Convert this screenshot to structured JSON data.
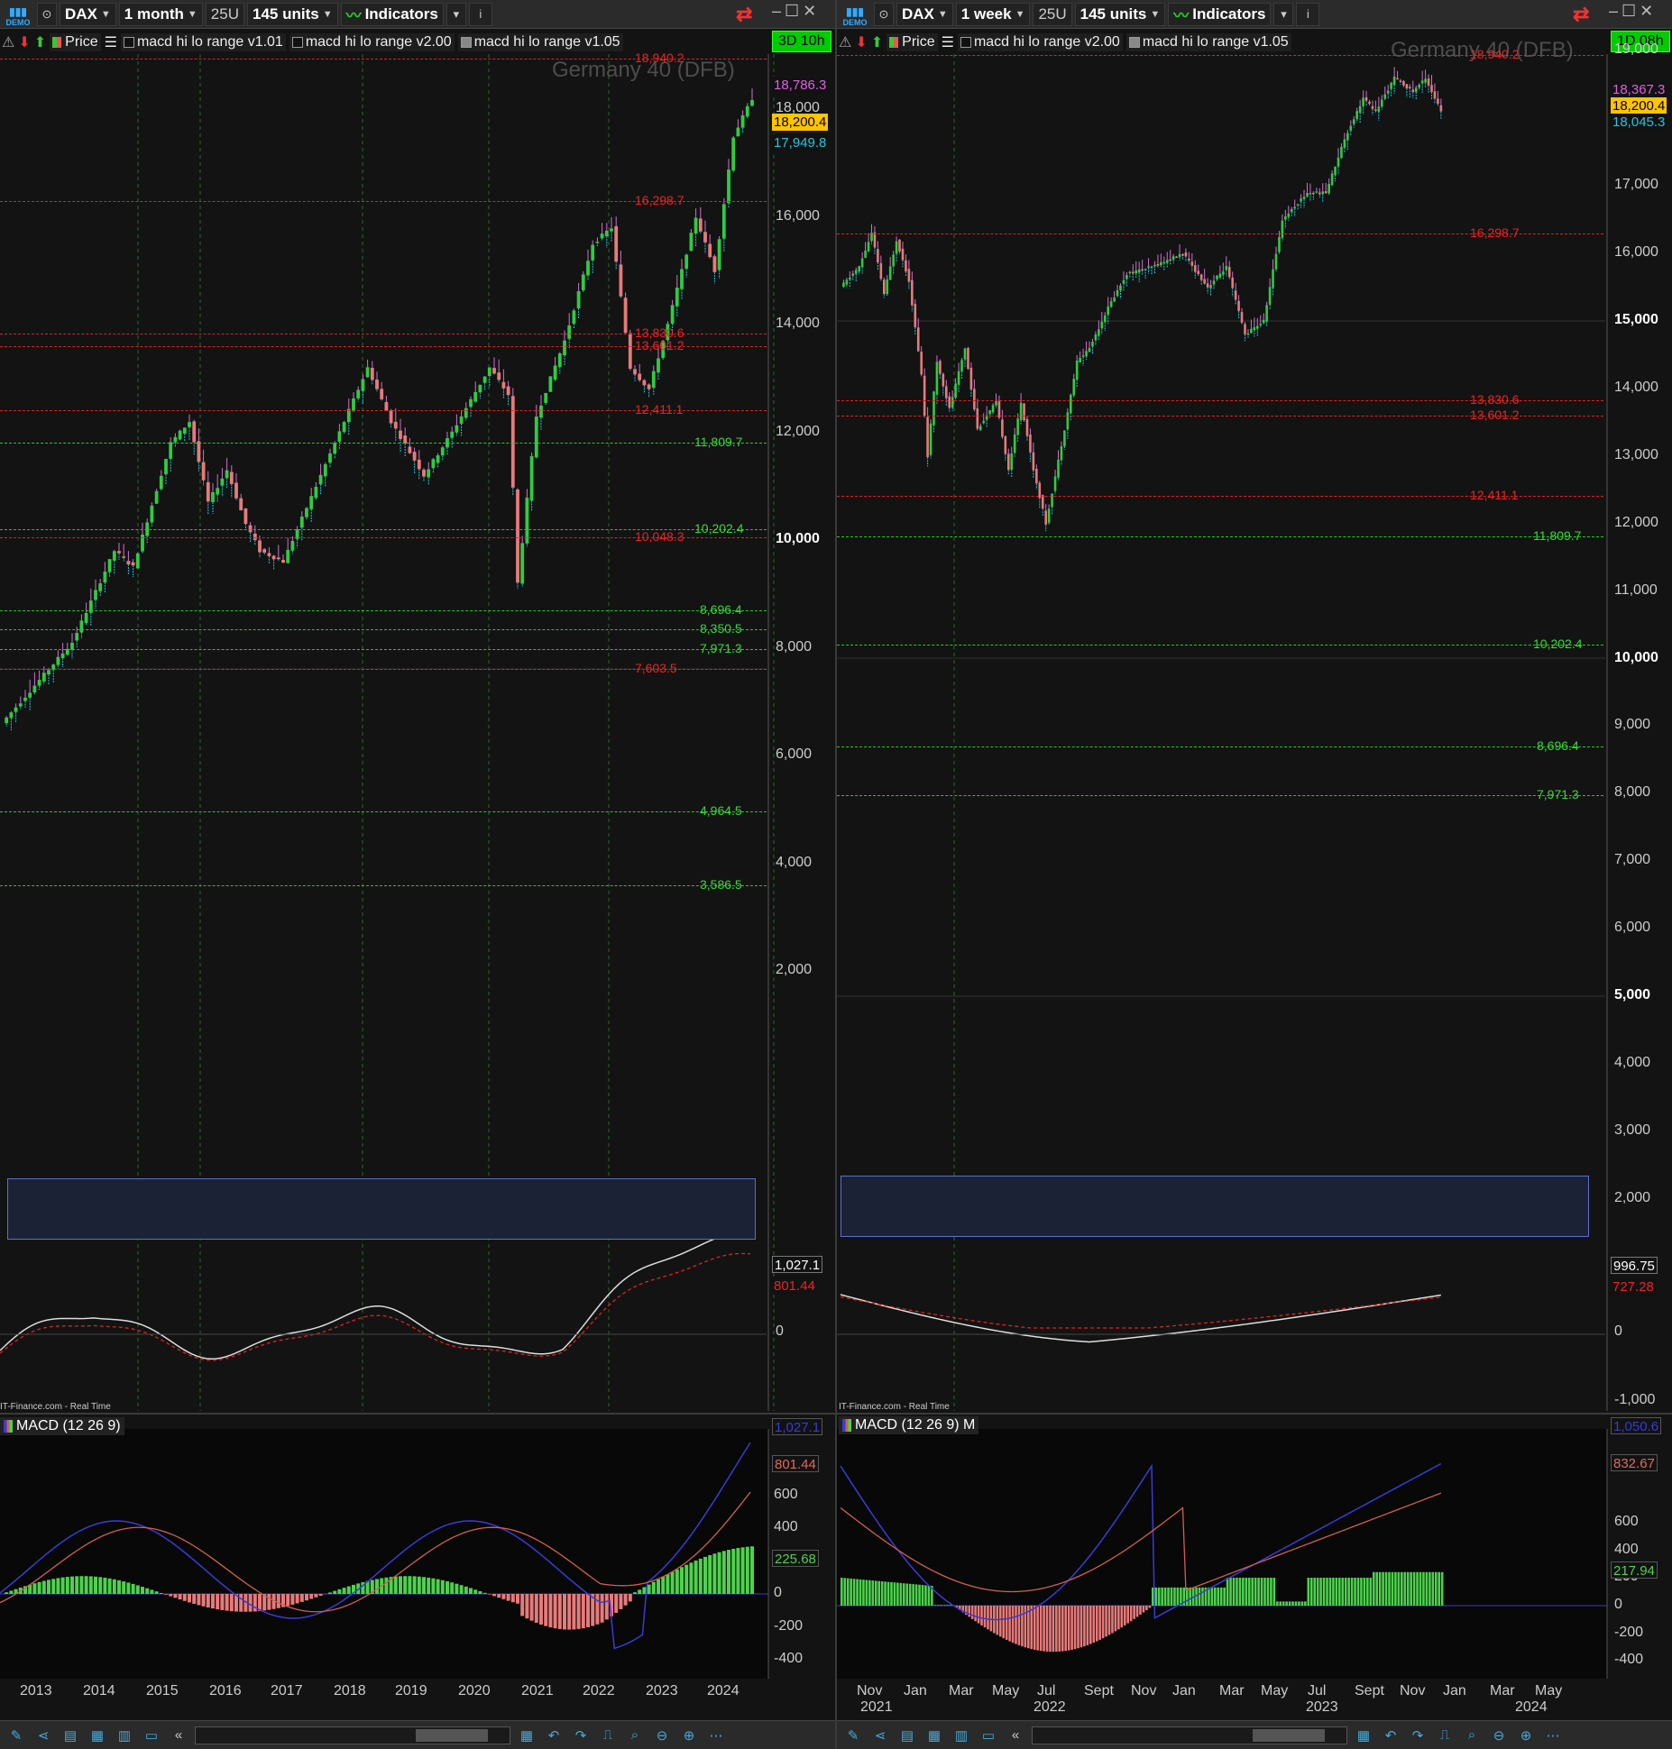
{
  "left": {
    "toolbar": {
      "demo": "DEMO",
      "instrument": "DAX",
      "timeframe": "1 month",
      "units_box": "25U",
      "units": "145 units",
      "indicators": "Indicators",
      "info": "i"
    },
    "indicator_bar": {
      "price": "Price",
      "items": [
        "macd hi lo range v1.01",
        "macd hi lo range v2.00",
        "macd hi lo range v1.05"
      ]
    },
    "badge": "3D 10h",
    "symbol": "Germany 40 (DFB)",
    "levels": [
      {
        "v": "18,940.2",
        "c": "red"
      },
      {
        "v": "16,298.7",
        "c": "red"
      },
      {
        "v": "13,830.6",
        "c": "red"
      },
      {
        "v": "13,601.2",
        "c": "red"
      },
      {
        "v": "12,411.1",
        "c": "red"
      },
      {
        "v": "11,809.7",
        "c": "green"
      },
      {
        "v": "10,202.4",
        "c": "green"
      },
      {
        "v": "10,048.3",
        "c": "red"
      },
      {
        "v": "8,696.4",
        "c": "green"
      },
      {
        "v": "8,350.5",
        "c": "green"
      },
      {
        "v": "7,971.3",
        "c": "green"
      },
      {
        "v": "7,603.5",
        "c": "red"
      },
      {
        "v": "4,964.5",
        "c": "green"
      },
      {
        "v": "3,586.5",
        "c": "green"
      }
    ],
    "price_axis": [
      "18,000",
      "16,000",
      "14,000",
      "12,000",
      "10,000",
      "8,000",
      "6,000",
      "4,000",
      "2,000"
    ],
    "tags": {
      "high": "18,786.3",
      "last": "18,200.4",
      "low": "17,949.8"
    },
    "sub": {
      "axis0": "0",
      "v1": "1,027.1",
      "v2": "801.44"
    },
    "footer": "IT-Finance.com - Real Time",
    "macd": {
      "title": "MACD (12 26 9)",
      "axis": [
        "600",
        "400",
        "200",
        "0",
        "-200",
        "-400"
      ],
      "v1": "1,027.1",
      "v2": "801.44",
      "v3": "225.68"
    },
    "xaxis": [
      "2013",
      "2014",
      "2015",
      "2016",
      "2017",
      "2018",
      "2019",
      "2020",
      "2021",
      "2022",
      "2023",
      "2024"
    ]
  },
  "right": {
    "toolbar": {
      "demo": "DEMO",
      "instrument": "DAX",
      "timeframe": "1 week",
      "units_box": "25U",
      "units": "145 units",
      "indicators": "Indicators",
      "info": "i"
    },
    "indicator_bar": {
      "price": "Price",
      "items": [
        "macd hi lo range v2.00",
        "macd hi lo range v1.05"
      ]
    },
    "badge": "1D 08h",
    "symbol": "Germany 40 (DFB)",
    "levels": [
      {
        "v": "18,940.2",
        "c": "red"
      },
      {
        "v": "16,298.7",
        "c": "red"
      },
      {
        "v": "13,830.6",
        "c": "red"
      },
      {
        "v": "13,601.2",
        "c": "red"
      },
      {
        "v": "12,411.1",
        "c": "red"
      },
      {
        "v": "11,809.7",
        "c": "green"
      },
      {
        "v": "10,202.4",
        "c": "green"
      },
      {
        "v": "8,696.4",
        "c": "green"
      },
      {
        "v": "7,971.3",
        "c": "green"
      }
    ],
    "price_axis": [
      "19,000",
      "17,000",
      "16,000",
      "15,000",
      "14,000",
      "13,000",
      "12,000",
      "11,000",
      "10,000",
      "9,000",
      "8,000",
      "7,000",
      "6,000",
      "5,000",
      "4,000",
      "3,000",
      "2,000"
    ],
    "tags": {
      "high": "18,367.3",
      "last": "18,200.4",
      "low": "18,045.3"
    },
    "sub": {
      "axis0": "0",
      "axisneg": "-1,000",
      "v1": "996.75",
      "v2": "727.28"
    },
    "footer": "IT-Finance.com - Real Time",
    "macd": {
      "title": "MACD (12 26 9) M",
      "axis": [
        "600",
        "400",
        "200",
        "0",
        "-200",
        "-400"
      ],
      "v1": "1,050.6",
      "v2": "832.67",
      "v3": "217.94"
    },
    "xaxis": [
      "Nov",
      "Jan",
      "Mar",
      "May",
      "Jul",
      "Sept",
      "Nov",
      "Jan",
      "Mar",
      "May",
      "Jul",
      "Sept",
      "Nov",
      "Jan",
      "Mar",
      "May"
    ],
    "xaxis_years": [
      "2021",
      "2022",
      "2023",
      "2024"
    ]
  },
  "colors": {
    "up": "#2ecc40",
    "down": "#e87a7a",
    "macd_line": "#3a3ad8",
    "signal_line": "#d0604a",
    "hist_pos": "#4cd34c",
    "hist_neg": "#e87a7a",
    "last_tag": "#ffc400",
    "high_tag": "#e060e0",
    "low_tag": "#20c8e0"
  },
  "icons": {
    "demo": "demo-icon",
    "candles": "candlestick-icon",
    "indicators": "indicators-icon",
    "sync": "sync-icon",
    "minimize": "minimize-icon",
    "maximize": "maximize-icon",
    "close": "close-icon"
  }
}
